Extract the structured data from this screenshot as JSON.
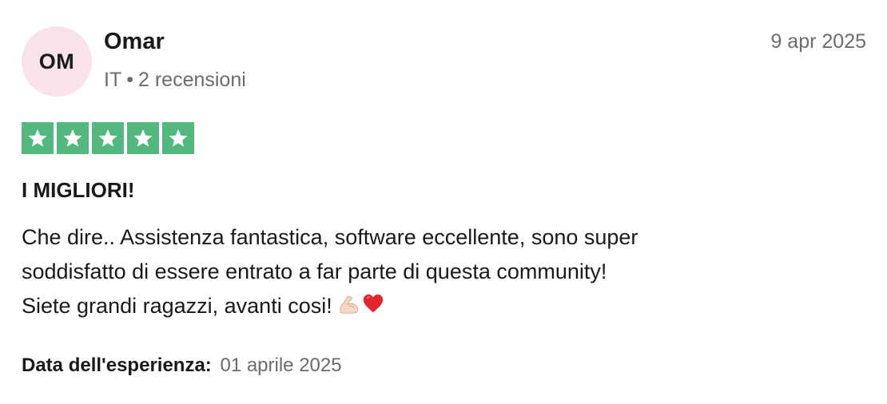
{
  "author": {
    "initials": "OM",
    "name": "Omar",
    "country": "IT",
    "separator": "•",
    "reviews_count": "2 recensioni"
  },
  "review": {
    "date": "9 apr 2025",
    "rating": 5,
    "rating_max": 5,
    "star_color": "#53b87d",
    "title": "I MIGLIORI!",
    "body_lines": [
      "Che dire.. Assistenza fantastica, software eccellente, sono super",
      "soddisfatto di essere entrato a far parte di questa community!",
      "Siete grandi ragazzi, avanti cosi!"
    ],
    "emojis": [
      "flexed-biceps-icon",
      "red-heart-icon"
    ]
  },
  "experience": {
    "label": "Data dell'esperienza:",
    "date": "01 aprile 2025"
  },
  "colors": {
    "avatar_bg": "#f9e3e8",
    "muted_text": "#6b6b6b",
    "text": "#191919"
  }
}
